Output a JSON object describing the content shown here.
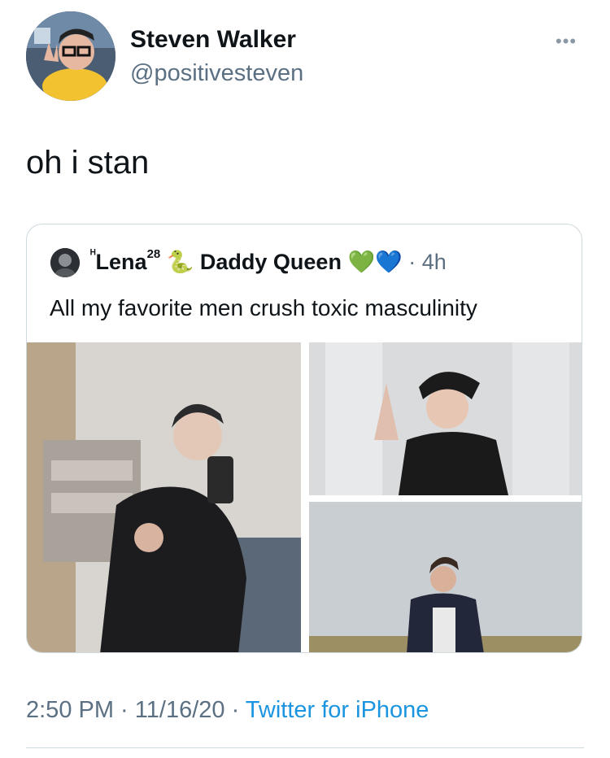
{
  "author": {
    "name": "Steven Walker",
    "handle": "@positivesteven"
  },
  "more_label": "•••",
  "tweet": {
    "text": "oh i stan"
  },
  "quote": {
    "display_name_prefix": "ᴴ",
    "display_name": "Lena",
    "superscript": "28",
    "name_suffix": "🐍 Daddy Queen 💚💙",
    "time": "4h",
    "text": "All my favorite men crush toxic masculinity"
  },
  "footer": {
    "time": "2:50 PM",
    "date": "11/16/20",
    "source": "Twitter for iPhone"
  },
  "colors": {
    "muted": "#5b7083",
    "link": "#1b95e0",
    "border": "#cfd9de"
  }
}
